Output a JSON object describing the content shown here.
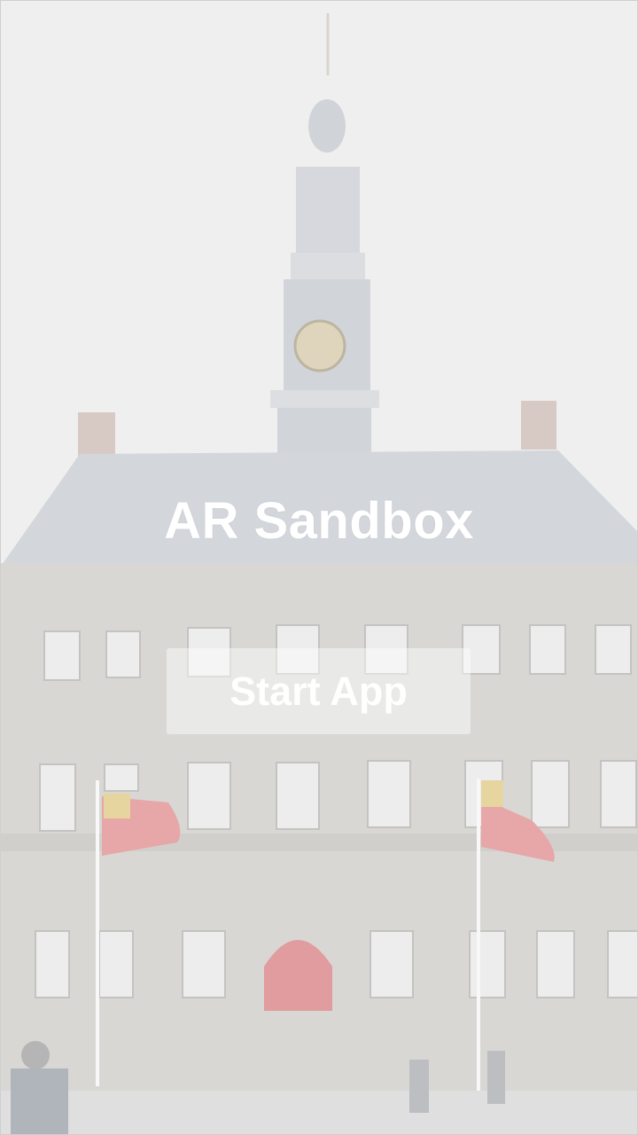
{
  "app": {
    "title": "AR Sandbox",
    "start_label": "Start App"
  },
  "colors": {
    "title_text": "#ffffff",
    "button_text": "#ffffff",
    "button_bg": "rgba(255,255,255,0.45)",
    "fog_overlay": "#f2f2f2",
    "roof": "#aeb4bf",
    "facade": "#b9b5ad",
    "door": "#c9343a",
    "flag_red": "#d9494e"
  },
  "background": {
    "description_icon": "city-hall-background-image"
  }
}
